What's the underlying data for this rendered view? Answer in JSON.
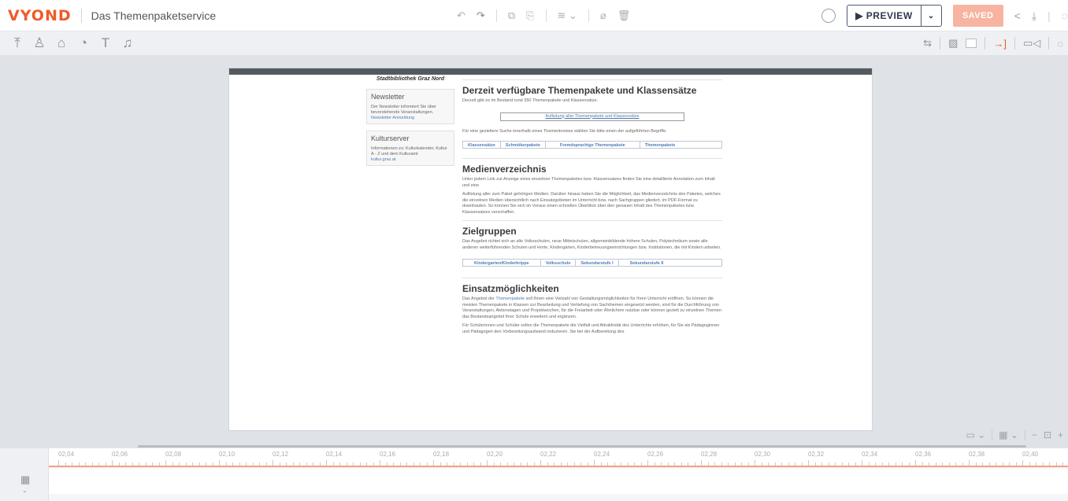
{
  "app": {
    "logo": "VYOND",
    "title": "Das Themenpaketservice"
  },
  "top_tools": {
    "undo_icon": "undo-icon",
    "redo_icon": "redo-icon",
    "copy_icon": "copy-icon",
    "paste_icon": "paste-icon",
    "layer_icon": "layer-icon",
    "erase_icon": "erase-icon",
    "delete_icon": "trash-icon",
    "settings_icon": "gear-icon",
    "preview_label": "▶ PREVIEW",
    "saved_label": "SAVED"
  },
  "sidebar": {
    "lib_name": "Stadtbibliothek Graz Nord",
    "newsletter": {
      "title": "Newsletter",
      "text": "Der Newsletter informiert Sie über bevorstehende Veranstaltungen.",
      "link": "Newsletter Anmeldung"
    },
    "kulturserver": {
      "title": "Kulturserver",
      "text": "Informationen zu: Kulturkalender, Kultur A - Z und dem Kulturamt",
      "link": "kultur.graz.at"
    }
  },
  "content": {
    "h_themen": "Derzeit verfügbare Themenpakete und Klassensätze",
    "p_bestand": "Derzeit gibt es im Bestand rund 350 Themenpakete und Klassensätze.",
    "btn_auflistung": "Auflistung aller Themenpakete und Klassensätze",
    "p_suche": "Für eine gezieltere Suche innerhalb eines Themenkreises wählen Sie bitte einen der aufgeführten Begriffe.",
    "tabs1": [
      "Klassensätze",
      "Schmökerpakete",
      "Fremdsprachige Themenpakete",
      "Themenpakete"
    ],
    "h_medien": "Medienverzeichnis",
    "p_medien1": "Unter jedem Link zur Anzeige eines einzelnen Themenpaketes bzw. Klassensatzes finden Sie eine detaillierte Annotation zum Inhalt und eine",
    "p_medien2": "Auflistung aller zum Paket gehörigen Medien. Darüber hinaus haben Sie die Möglichkeit, das Medienverzeichnis des Paketes, welches die einzelnen Medien übersichtlich nach Einsatzgebieten im Unterricht bzw. nach Sachgruppen gliedert, im PDF-Format zu downloaden. So können Sie sich im Voraus einen schnellen Überblick über den genauen Inhalt des Themenpaketes bzw. Klassensatzes verschaffen.",
    "h_ziel": "Zielgruppen",
    "p_ziel": "Das Angebot richtet sich an alle Volksschulen, neue Mittelschulen, allgemeinbildende höhere Schulen, Polytechnikum sowie alle anderen weiterführenden Schulen und Horte, Kindergärten, Kinderbetreuungseinrichtungen bzw. Institutionen, die mit Kindern arbeiten.",
    "tabs2": [
      "Kindergarten/Kinderkrippe",
      "Volksschule",
      "Sekundarstufe I",
      "Sekundarstufe II"
    ],
    "h_einsatz": "Einsatzmöglichkeiten",
    "p_einsatz1_a": "Das Angebot der ",
    "p_einsatz1_link": "Themenpakete",
    "p_einsatz1_b": " soll Ihnen eine Vielzahl von Gestaltungsmöglichkeiten für Ihren Unterricht eröffnen. So können die meisten Themenpakete in Klassen zur Bearbeitung und Vertiefung von Sachthemen eingesetzt werden, sind für die Durchführung von Veranstaltungen, Aktionstagen und Projektwochen, für die Freiarbeit oder Ähnlichem nutzbar oder können gezielt zu einzelnen Themen das Bestandsangebot Ihrer Schule erweitern und ergänzen.",
    "p_einsatz2": "Für Schülerinnen und Schüler sollen die Themenpakete die Vielfalt und Attraktivität des Unterrichts erhöhen, für Sie als Pädagoginnen und Pädagogen den Vorbereitungsaufwand reduzieren. Sie bei der Aufbereitung des"
  },
  "timeline": {
    "ticks": [
      "02,04",
      "02,06",
      "02,08",
      "02,10",
      "02,12",
      "02,14",
      "02,16",
      "02,18",
      "02,20",
      "02,22",
      "02,24",
      "02,26",
      "02,28",
      "02,30",
      "02,32",
      "02,34",
      "02,36",
      "02,38",
      "02,40"
    ]
  }
}
